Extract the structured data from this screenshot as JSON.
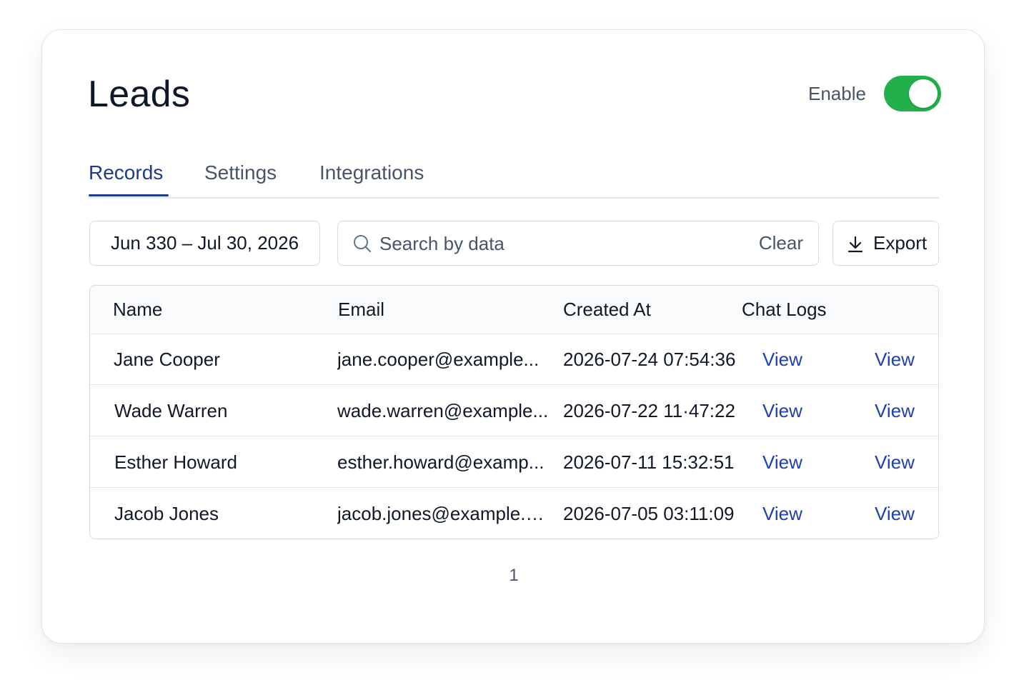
{
  "header": {
    "title": "Leads",
    "enable_label": "Enable",
    "enabled": true,
    "toggle_color": "#22b04b"
  },
  "tabs": [
    {
      "label": "Records",
      "active": true
    },
    {
      "label": "Settings",
      "active": false
    },
    {
      "label": "Integrations",
      "active": false
    }
  ],
  "toolbar": {
    "date_range": "Jun 330 – Jul 30, 2026",
    "search_placeholder": "Search by data",
    "search_value": "",
    "clear_label": "Clear",
    "export_label": "Export",
    "search_icon": "search-icon",
    "export_icon": "download-icon"
  },
  "table": {
    "headers": [
      "Name",
      "Email",
      "Created At",
      "Chat Logs"
    ],
    "rows": [
      {
        "name": "Jane Cooper",
        "email": "jane.cooper@example...",
        "created_at": "2026-07-24 07:54:36",
        "chat_logs": "View",
        "action": "View"
      },
      {
        "name": "Wade Warren",
        "email": "wade.warren@example...",
        "created_at": "2026-07-22 11·47:22",
        "chat_logs": "View",
        "action": "View"
      },
      {
        "name": "Esther Howard",
        "email": "esther.howard@examp...",
        "created_at": "2026-07-11 15:32:51",
        "chat_logs": "View",
        "action": "View"
      },
      {
        "name": "Jacob Jones",
        "email": "jacob.jones@example.c...",
        "created_at": "2026-07-05 03:11:09",
        "chat_logs": "View",
        "action": "View"
      }
    ]
  },
  "pagination": {
    "current_page": "1"
  },
  "colors": {
    "accent": "#1e3a8a",
    "link": "#1e40af",
    "muted": "#475569"
  }
}
